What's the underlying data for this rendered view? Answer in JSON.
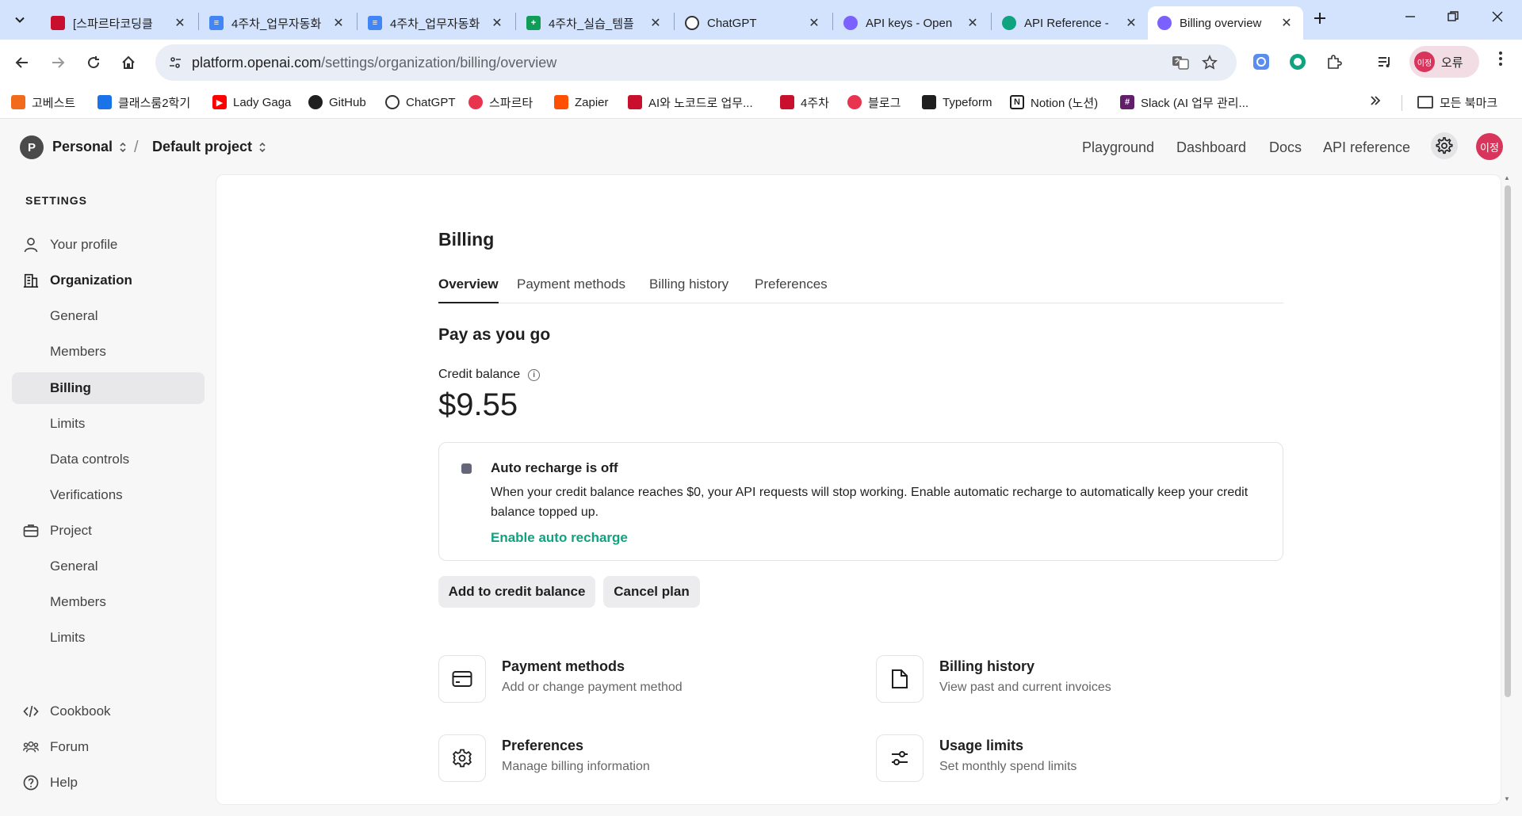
{
  "browser": {
    "tabs": [
      {
        "title": "[스파르타코딩클",
        "favicon": "sparta-book-icon",
        "color": "#c8102e"
      },
      {
        "title": "4주차_업무자동화",
        "favicon": "google-docs-icon",
        "color": "#4285f4"
      },
      {
        "title": "4주차_업무자동화",
        "favicon": "google-docs-icon",
        "color": "#4285f4"
      },
      {
        "title": "4주차_실습_템플",
        "favicon": "google-sheets-icon",
        "color": "#0f9d58"
      },
      {
        "title": "ChatGPT",
        "favicon": "openai-icon",
        "color": "#1f1f1f"
      },
      {
        "title": "API keys - Open",
        "favicon": "openai-purple-icon",
        "color": "#7b61ff"
      },
      {
        "title": "API Reference -",
        "favicon": "openai-green-icon",
        "color": "#10a37f"
      },
      {
        "title": "Billing overview",
        "favicon": "openai-purple-icon",
        "color": "#7b61ff"
      }
    ],
    "close_glyph": "✕",
    "url_host": "platform.openai.com",
    "url_path": "/settings/organization/billing/overview",
    "profile_label": "오류",
    "profile_initials": "이정",
    "bookmarks": [
      {
        "label": "고베스트",
        "icon": "gobest-icon",
        "color": "#f26b1d"
      },
      {
        "label": "클래스룸2학기",
        "icon": "classroom-icon",
        "color": "#1a73e8"
      },
      {
        "label": "Lady Gaga",
        "icon": "youtube-icon",
        "color": "#ff0000"
      },
      {
        "label": "GitHub",
        "icon": "github-icon",
        "color": "#1f1f1f"
      },
      {
        "label": "ChatGPT",
        "icon": "openai-icon",
        "color": "#1f1f1f"
      },
      {
        "label": "스파르타",
        "icon": "sparta-heart-icon",
        "color": "#e8344e"
      },
      {
        "label": "Zapier",
        "icon": "zapier-icon",
        "color": "#ff4f00"
      },
      {
        "label": "AI와 노코드로 업무...",
        "icon": "sparta-book-icon",
        "color": "#c8102e"
      },
      {
        "label": "4주차",
        "icon": "sparta-book-icon",
        "color": "#c8102e"
      },
      {
        "label": "블로그",
        "icon": "sparta-heart-icon",
        "color": "#e8344e"
      },
      {
        "label": "Typeform",
        "icon": "typeform-icon",
        "color": "#1f1f1f"
      },
      {
        "label": "Notion (노션)",
        "icon": "notion-icon",
        "color": "#1f1f1f"
      },
      {
        "label": "Slack (AI 업무 관리...",
        "icon": "slack-icon",
        "color": "#611f69"
      }
    ],
    "bookmarks_folder": "모든 북마크"
  },
  "header": {
    "org_initial": "P",
    "org_name": "Personal",
    "project_name": "Default project",
    "crumb_separator": "/",
    "links": [
      "Playground",
      "Dashboard",
      "Docs",
      "API reference"
    ],
    "user_initials": "이정"
  },
  "sidebar": {
    "heading": "SETTINGS",
    "items": [
      {
        "label": "Your profile",
        "icon": "user-icon",
        "kind": "section-plain"
      },
      {
        "label": "Organization",
        "icon": "building-icon",
        "kind": "section"
      },
      {
        "label": "General",
        "kind": "sub"
      },
      {
        "label": "Members",
        "kind": "sub"
      },
      {
        "label": "Billing",
        "kind": "sub",
        "active": true
      },
      {
        "label": "Limits",
        "kind": "sub"
      },
      {
        "label": "Data controls",
        "kind": "sub"
      },
      {
        "label": "Verifications",
        "kind": "sub"
      },
      {
        "label": "Project",
        "icon": "briefcase-icon",
        "kind": "section-plain"
      },
      {
        "label": "General",
        "kind": "sub"
      },
      {
        "label": "Members",
        "kind": "sub"
      },
      {
        "label": "Limits",
        "kind": "sub"
      },
      {
        "label": "Cookbook",
        "icon": "code-icon",
        "kind": "footer"
      },
      {
        "label": "Forum",
        "icon": "people-icon",
        "kind": "footer"
      },
      {
        "label": "Help",
        "icon": "help-icon",
        "kind": "footer"
      }
    ]
  },
  "billing": {
    "title": "Billing",
    "tabs": [
      "Overview",
      "Payment methods",
      "Billing history",
      "Preferences"
    ],
    "active_tab": "Overview",
    "plan_title": "Pay as you go",
    "credit_label": "Credit balance",
    "credit_amount": "$9.55",
    "auto_recharge": {
      "title": "Auto recharge is off",
      "description": "When your credit balance reaches $0, your API requests will stop working. Enable automatic recharge to automatically keep your credit balance topped up.",
      "link": "Enable auto recharge"
    },
    "buttons": {
      "add_credit": "Add to credit balance",
      "cancel_plan": "Cancel plan"
    },
    "cards": [
      {
        "title": "Payment methods",
        "subtitle": "Add or change payment method",
        "icon": "credit-card-icon"
      },
      {
        "title": "Billing history",
        "subtitle": "View past and current invoices",
        "icon": "document-icon"
      },
      {
        "title": "Preferences",
        "subtitle": "Manage billing information",
        "icon": "gear-icon"
      },
      {
        "title": "Usage limits",
        "subtitle": "Set monthly spend limits",
        "icon": "sliders-icon"
      }
    ]
  },
  "colors": {
    "accent_green": "#10a37f",
    "avatar_pink": "#d9345c",
    "tabstrip": "#d3e3fd"
  }
}
